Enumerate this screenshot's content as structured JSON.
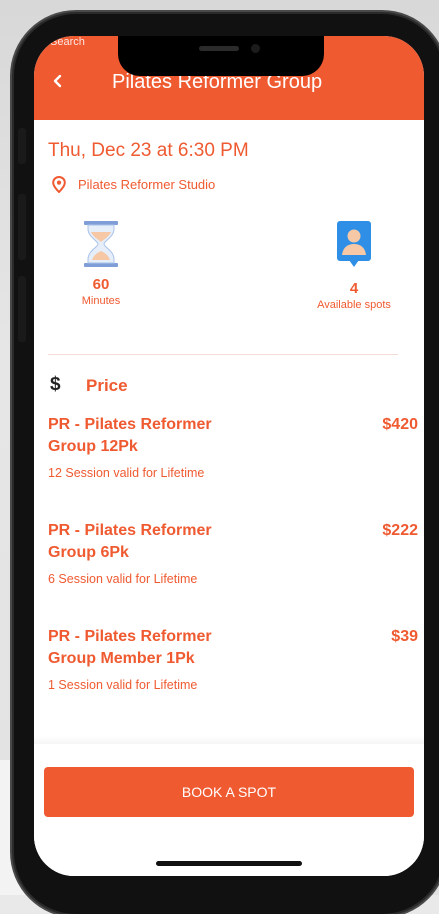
{
  "status_bar": {
    "left_text": "Search"
  },
  "header": {
    "title": "Pilates Reformer Group",
    "back_icon": "chevron-left-icon"
  },
  "session": {
    "datetime": "Thu, Dec 23 at 6:30 PM",
    "location": "Pilates Reformer Studio"
  },
  "stats": {
    "duration": {
      "value": "60",
      "label": "Minutes",
      "icon": "hourglass-icon"
    },
    "spots": {
      "value": "4",
      "label": "Available spots",
      "icon": "person-pin-icon"
    }
  },
  "price_section": {
    "icon": "dollar-icon",
    "icon_glyph": "$",
    "title": "Price",
    "items": [
      {
        "name": "PR - Pilates Reformer Group 12Pk",
        "price": "$420",
        "description": "12 Session valid for Lifetime"
      },
      {
        "name": "PR - Pilates Reformer Group 6Pk",
        "price": "$222",
        "description": "6 Session valid for Lifetime"
      },
      {
        "name": "PR - Pilates Reformer Group Member 1Pk",
        "price": "$39",
        "description": "1 Session valid for Lifetime"
      }
    ]
  },
  "footer": {
    "book_label": "BOOK A SPOT"
  },
  "colors": {
    "accent": "#ef5a31",
    "phone_frame": "#111111",
    "background": "#e9e9e9"
  }
}
